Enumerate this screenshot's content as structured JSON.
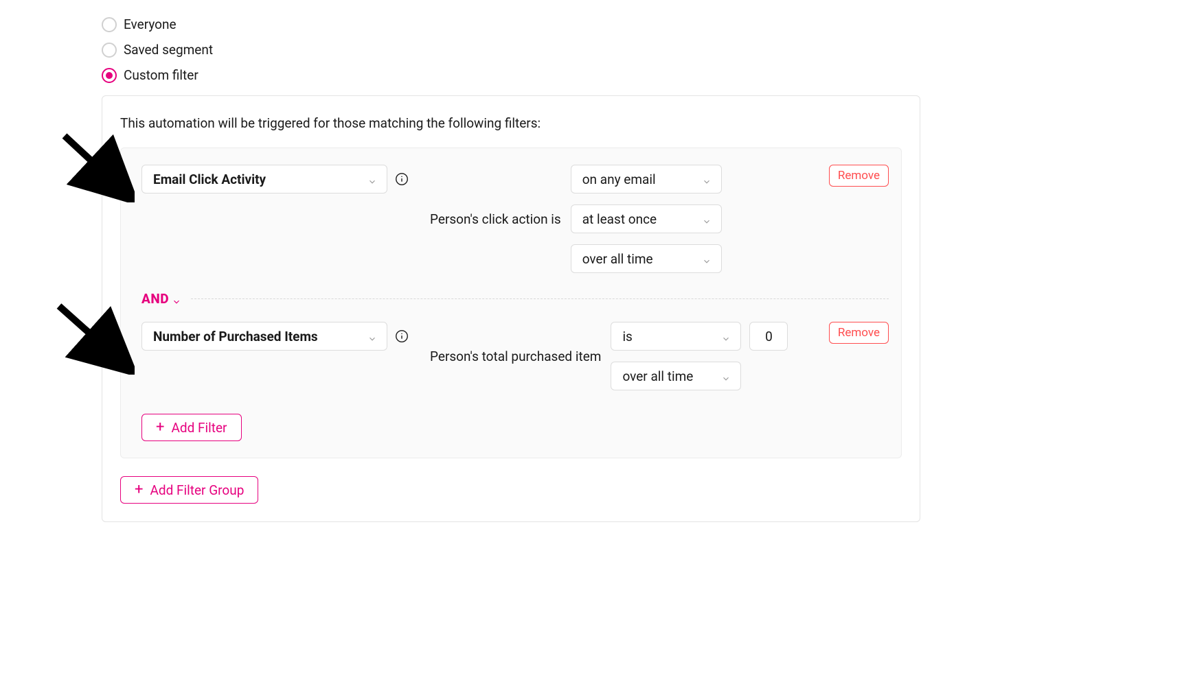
{
  "radios": {
    "everyone": "Everyone",
    "saved_segment": "Saved segment",
    "custom_filter": "Custom filter",
    "selected": "custom_filter"
  },
  "panel": {
    "description": "This automation will be triggered for those matching the following filters:"
  },
  "filter1": {
    "type_label": "Email Click Activity",
    "sentence": "Person's click action is",
    "target": "on any email",
    "freq": "at least once",
    "range": "over all time",
    "remove": "Remove"
  },
  "operator": {
    "and": "AND"
  },
  "filter2": {
    "type_label": "Number of Purchased Items",
    "sentence": "Person's total purchased item",
    "op": "is",
    "value": "0",
    "range": "over all time",
    "remove": "Remove"
  },
  "buttons": {
    "add_filter": "Add Filter",
    "add_filter_group": "Add Filter Group"
  }
}
